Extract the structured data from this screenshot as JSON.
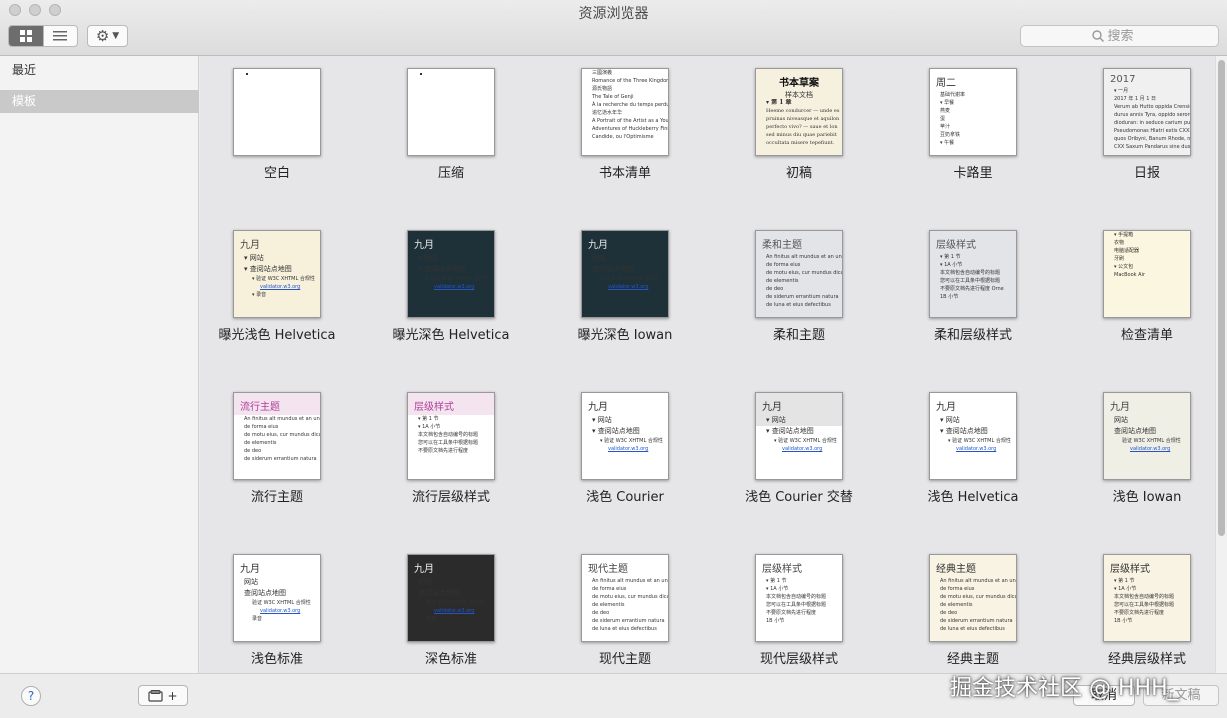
{
  "window": {
    "title": "资源浏览器"
  },
  "toolbar": {
    "search_placeholder": "搜索"
  },
  "sidebar": {
    "items": [
      {
        "label": "最近",
        "selected": false
      },
      {
        "label": "模板",
        "selected": true
      }
    ]
  },
  "templates": [
    {
      "name": "空白",
      "thumb": {
        "style": "blank",
        "lines": []
      }
    },
    {
      "name": "压缩",
      "thumb": {
        "style": "blank",
        "lines": []
      }
    },
    {
      "name": "书本清单",
      "thumb": {
        "style": "list",
        "bg": "#ffffff",
        "fg": "#333333",
        "lines": [
          "三國演義",
          "Romance of the Three Kingdoms",
          "源氏物語",
          "The Tale of Genji",
          "À la recherche du temps perdu",
          "追忆逝水年华",
          "A Portrait of the Artist as a Young",
          "Adventures of Huckleberry Finn",
          "Candide, ou l'Optimisme"
        ]
      }
    },
    {
      "name": "初稿",
      "thumb": {
        "style": "serif",
        "bg": "#f6f0df",
        "fg": "#222222",
        "head": "书本草案",
        "lines": [
          "样本文档",
          "▾ 第 1 章",
          "Heeme condurcer — unde es",
          "pruinas niveasque et aquilon",
          "perfecto vivo? — saue et lon",
          "sed minus diu quae pariebit",
          "occultata misere tepefiunt."
        ]
      }
    },
    {
      "name": "卡路里",
      "thumb": {
        "style": "list",
        "bg": "#ffffff",
        "fg": "#333333",
        "head": "周二",
        "lines": [
          "基础代谢率",
          "▾ 早餐",
          "燕麦",
          "蛋",
          "苹汁",
          "豆奶拿铁",
          "▾ 午餐"
        ]
      }
    },
    {
      "name": "日报",
      "thumb": {
        "style": "journal",
        "bg": "#f0f0f0",
        "fg": "#555555",
        "head": "2017",
        "lines": [
          "▾ 一月",
          "2017 年 1 月 1 日",
          "Verum ab Hutto oppida Crensio",
          "durus annis Tyra, oppido serore",
          "dioduran: in seduce carium pure",
          "Pseudomonas Hlatri extis CXXX",
          "quos Oribyni, Banum Rhode, nisi",
          "CXX Saxum Pandarus sine dust"
        ]
      }
    },
    {
      "name": "曝光浅色 Helvetica",
      "thumb": {
        "style": "outline",
        "bg": "#f7f1dc",
        "fg": "#444444",
        "head": "九月",
        "lines": [
          "▾ 网站",
          "▾ 查阅站点地图",
          "▾ 验证 W3C XHTML 合规性",
          "validator.w3.org",
          "▾ 录音"
        ]
      }
    },
    {
      "name": "曝光深色 Helvetica",
      "thumb": {
        "style": "outline",
        "bg": "#1e3138",
        "fg": "#e8e8e8",
        "head": "九月",
        "lines": [
          "▾ 网站",
          "▾ 查阅站点地图",
          "▾ 验证 W3C XHTML 合规性",
          "validator.w3.org"
        ]
      }
    },
    {
      "name": "曝光深色 Iowan",
      "thumb": {
        "style": "outline",
        "bg": "#1e3138",
        "fg": "#e8e8e8",
        "head": "九月",
        "lines": [
          "网站",
          "查阅站点地图",
          "验证 W3C XHTML 合规性",
          "validator.w3.org"
        ]
      }
    },
    {
      "name": "柔和主题",
      "thumb": {
        "style": "bullets",
        "bg": "#e3e4e8",
        "fg": "#555555",
        "head": "柔和主题",
        "lines": [
          "An finitus alt mundus et an unus",
          "de forma eius",
          "de motu eius, cur mundus dicatur",
          "de elementis",
          "de deo",
          "de siderum errantium natura",
          "de luna et eius defectibus"
        ]
      }
    },
    {
      "name": "柔和层级样式",
      "thumb": {
        "style": "bullets",
        "bg": "#e3e4e8",
        "fg": "#555555",
        "head": "层级样式",
        "lines": [
          "▾ 第 1 节",
          "▾ 1A 小节",
          "本文档包含自动编号的标题",
          "您可以在工具条中根据标题",
          "不要原文档先进行程度 Orne",
          "1B 小节"
        ]
      }
    },
    {
      "name": "检查清单",
      "thumb": {
        "style": "check",
        "bg": "#fbf6df",
        "fg": "#333333",
        "lines": [
          "▾ 手提箱",
          "衣物",
          "电脑适配器",
          "牙刷",
          "▾ 公文包",
          "MacBook Air"
        ]
      }
    },
    {
      "name": "流行主题",
      "thumb": {
        "style": "bullets",
        "bg": "#ffffff",
        "fg": "#555555",
        "head": "流行主题",
        "headColor": "#b0409a",
        "band": "#f3e4ef",
        "lines": [
          "An finitus alt mundus et an unus",
          "de forma eius",
          "de motu eius, cur mundus dicatur",
          "de elementis",
          "de deo",
          "de siderum errantium natura"
        ]
      }
    },
    {
      "name": "流行层级样式",
      "thumb": {
        "style": "bullets",
        "bg": "#ffffff",
        "fg": "#555555",
        "head": "层级样式",
        "headColor": "#b0409a",
        "band": "#f3e4ef",
        "lines": [
          "▾ 第 1 节",
          "▾ 1A 小节",
          "本文档包含自动编号的标题",
          "您可以在工具条中根据标题",
          "不要原文档先进行程度"
        ]
      }
    },
    {
      "name": "浅色 Courier",
      "thumb": {
        "style": "outline",
        "bg": "#ffffff",
        "fg": "#333333",
        "head": "九月",
        "lines": [
          "▾ 网站",
          "▾ 查阅站点地图",
          "▾ 验证 W3C XHTML 合规性",
          "validator.w3.org"
        ]
      }
    },
    {
      "name": "浅色 Courier 交替",
      "thumb": {
        "style": "outline",
        "bg": "#ffffff",
        "fg": "#333333",
        "head": "九月",
        "band": "#e4e4e4",
        "lines": [
          "▾ 网站",
          "▾ 查阅站点地图",
          "▾ 验证 W3C XHTML 合规性",
          "validator.w3.org"
        ]
      }
    },
    {
      "name": "浅色 Helvetica",
      "thumb": {
        "style": "outline",
        "bg": "#ffffff",
        "fg": "#333333",
        "head": "九月",
        "lines": [
          "▾ 网站",
          "▾ 查阅站点地图",
          "▾ 验证 W3C XHTML 合规性",
          "validator.w3.org"
        ]
      }
    },
    {
      "name": "浅色 Iowan",
      "thumb": {
        "style": "outline",
        "bg": "#f0efe6",
        "fg": "#444444",
        "head": "九月",
        "lines": [
          "网站",
          "查阅站点地图",
          "验证 W3C XHTML 合规性",
          "validator.w3.org"
        ]
      }
    },
    {
      "name": "浅色标准",
      "thumb": {
        "style": "outline",
        "bg": "#ffffff",
        "fg": "#333333",
        "head": "九月",
        "lines": [
          "网站",
          "查阅站点地图",
          "验证 W3C XHTML 合规性",
          "validator.w3.org",
          "录音"
        ]
      }
    },
    {
      "name": "深色标准",
      "thumb": {
        "style": "outline",
        "bg": "#2b2b2b",
        "fg": "#f0f0f0",
        "head": "九月",
        "lines": [
          "网站",
          "查阅站点地图",
          "验证 W3C XHTML 合规性",
          "validator.w3.org",
          "录音"
        ]
      }
    },
    {
      "name": "现代主题",
      "thumb": {
        "style": "bullets",
        "bg": "#ffffff",
        "fg": "#444444",
        "head": "现代主题",
        "lines": [
          "An finitus alt mundus et an unus",
          "de forma eius",
          "de motu eius, cur mundus dicatur",
          "de elementis",
          "de deo",
          "de siderum errantium natura",
          "de luna et eius defectibus"
        ]
      }
    },
    {
      "name": "现代层级样式",
      "thumb": {
        "style": "bullets",
        "bg": "#ffffff",
        "fg": "#444444",
        "head": "层级样式",
        "lines": [
          "▾ 第 1 节",
          "▾ 1A 小节",
          "本文档包含自动编号的标题",
          "您可以在工具条中根据标题",
          "不要原文档先进行程度",
          "1B 小节"
        ]
      }
    },
    {
      "name": "经典主题",
      "thumb": {
        "style": "bullets",
        "bg": "#f8f3e3",
        "fg": "#333333",
        "head": "经典主题",
        "lines": [
          "An finitus alt mundus et an unus",
          "de forma eius",
          "de motu eius, cur mundus dicatur",
          "de elementis",
          "de deo",
          "de siderum errantium natura",
          "de luna et eius defectibus"
        ]
      }
    },
    {
      "name": "经典层级样式",
      "thumb": {
        "style": "bullets",
        "bg": "#f8f3e3",
        "fg": "#333333",
        "head": "层级样式",
        "lines": [
          "▾ 第 1 节",
          "▾ 1A 小节",
          "本文档包含自动编号的标题",
          "您可以在工具条中根据标题",
          "不要原文档先进行程度",
          "1B 小节"
        ]
      }
    }
  ],
  "bottom": {
    "help_label": "?",
    "add_label": "+",
    "cancel_label": "取消",
    "new_label": "新文稿"
  },
  "watermark": "掘金技术社区 @ HHH_"
}
